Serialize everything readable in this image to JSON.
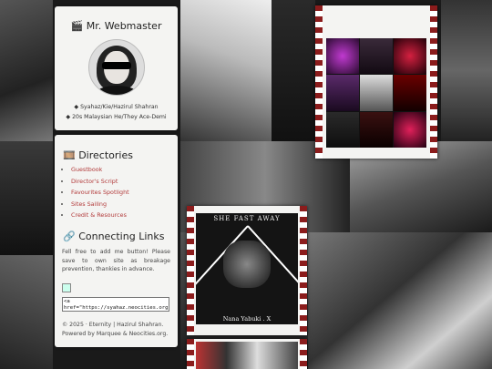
{
  "profile": {
    "title_icon": "clapper-icon",
    "title": "Mr. Webmaster",
    "names": "◆ Syahaz/Kie/Hazirul Shahran",
    "about": "◆ 20s Malaysian He/They Ace-Demi"
  },
  "directories": {
    "icon": "film-icon",
    "heading": "Directories",
    "items": [
      {
        "label": "Guestbook"
      },
      {
        "label": "Director's Script"
      },
      {
        "label": "Favourites Spotlight"
      },
      {
        "label": "Sites Sailing"
      },
      {
        "label": "Credit & Resources"
      }
    ]
  },
  "connecting": {
    "icon": "link-icon",
    "heading": "Connecting Links",
    "text": "Fell free to add me button! Please save to own site as breakage prevention, thankies in advance.",
    "code": "<a\nhref=\"https://syahaz.neocities.org"
  },
  "footer": {
    "line1": "© 2025 · Eternity | Hazirul Shahran.",
    "line2": "Powered by Marquee & Neocities.org."
  },
  "poster": {
    "top_text": "SHE FAST AWAY",
    "bottom_text": "Nana Yabuki . X"
  },
  "colors": {
    "accent": "#b23a3a",
    "strip_red": "#8b1c1c",
    "panel_bg": "#f4f4f2"
  }
}
